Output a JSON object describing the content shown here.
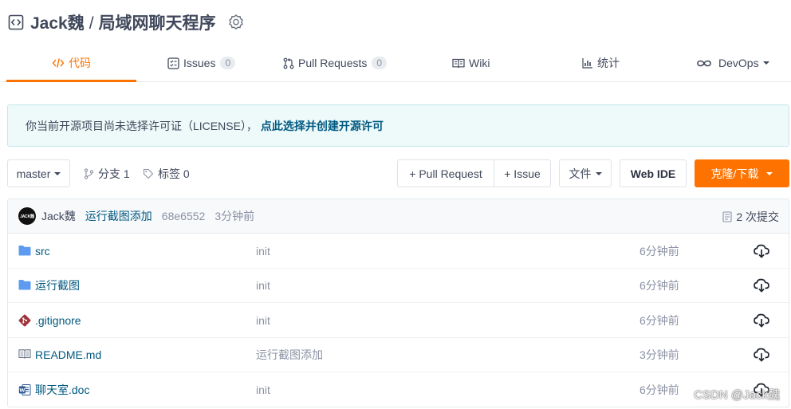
{
  "header": {
    "owner": "Jack魏",
    "separator": "/",
    "repo": "局域网聊天程序"
  },
  "tabs": [
    {
      "label": "代码",
      "active": true,
      "icon": "code-icon"
    },
    {
      "label": "Issues",
      "count": "0",
      "icon": "issues-icon"
    },
    {
      "label": "Pull Requests",
      "count": "0",
      "icon": "pull-request-icon"
    },
    {
      "label": "Wiki",
      "icon": "wiki-icon"
    },
    {
      "label": "统计",
      "icon": "stats-icon"
    },
    {
      "label": "DevOps",
      "icon": "devops-icon"
    }
  ],
  "notice": {
    "text": "你当前开源项目尚未选择许可证（LICENSE），",
    "link": "点此选择并创建开源许可"
  },
  "toolbar": {
    "branch": "master",
    "branches_label": "分支 1",
    "tags_label": "标签 0",
    "pull_request_button": "+ Pull Request",
    "issue_button": "+ Issue",
    "file_button": "文件",
    "web_ide_button": "Web IDE",
    "clone_button": "克隆/下载"
  },
  "commit": {
    "author": "Jack魏",
    "message": "运行截图添加",
    "hash": "68e6552",
    "time": "3分钟前",
    "count": "2 次提交",
    "avatar_text": "JACK魏"
  },
  "files": [
    {
      "name": "src",
      "type": "folder",
      "message": "init",
      "time": "6分钟前"
    },
    {
      "name": "运行截图",
      "type": "folder",
      "message": "init",
      "time": "6分钟前"
    },
    {
      "name": ".gitignore",
      "type": "git",
      "message": "init",
      "time": "6分钟前"
    },
    {
      "name": "README.md",
      "type": "readme",
      "message": "运行截图添加",
      "time": "3分钟前"
    },
    {
      "name": "聊天室.doc",
      "type": "word",
      "message": "init",
      "time": "6分钟前"
    }
  ],
  "watermark": "CSDN @Jack魏",
  "colors": {
    "accent": "#fe7300",
    "link": "#005980",
    "folder": "#5c9bf0"
  }
}
